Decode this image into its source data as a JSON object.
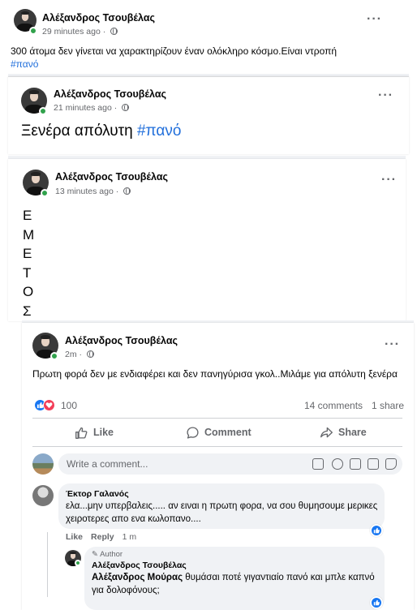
{
  "post1": {
    "author": "Αλέξανδρος Τσουβέλας",
    "time": "29 minutes ago · ",
    "text": "300 άτομα δεν γίνεται να χαρακτηρίζουν έναν ολόκληρο κόσμο.Είναι ντροπή ",
    "hashtag": "#πανό",
    "more": "···"
  },
  "post2": {
    "author": "Αλέξανδρος Τσουβέλας",
    "time": "21 minutes ago · ",
    "text": "Ξενέρα απόλυτη ",
    "hashtag": "#πανό",
    "more": "···"
  },
  "post3": {
    "author": "Αλέξανδρος Τσουβέλας",
    "time": "13 minutes ago · ",
    "letters": [
      "Ε",
      "Μ",
      "Ε",
      "Τ",
      "Ο",
      "Σ"
    ],
    "more": "···"
  },
  "post4": {
    "author": "Αλέξανδρος Τσουβέλας",
    "time": "2m · ",
    "text": "Πρωτη φορά δεν με ενδιαφέρει και δεν πανηγύρισα γκολ..Μιλάμε για απόλυτη ξενέρα",
    "more": "···",
    "reaction_count": "100",
    "comments_count": "14 comments",
    "shares_count": "1 share",
    "actions": {
      "like": "Like",
      "comment": "Comment",
      "share": "Share"
    },
    "comment_placeholder": "Write a comment..."
  },
  "comments": [
    {
      "author": "Έκτορ Γαλανός",
      "text": "ελα...μην υπερβαλεις..... αν ειναι η πρωτη φορα, να σου θυμησουμε μερικες χειροτερες απο ενα κωλοπανο....",
      "like": "Like",
      "reply": "Reply",
      "time": "1 m"
    },
    {
      "badge": "Author",
      "author": "Αλέξανδρος Τσουβέλας",
      "tag": "Αλέξανδρος Μούρας",
      "text": " θυμάσαι ποτέ γιγαντιαίο πανό και μπλε καπνό για δολοφόνους;"
    }
  ],
  "colors": {
    "link": "#216fdb",
    "online": "#31a24c",
    "like": "#1877f2",
    "love": "#f33e58"
  },
  "icons": [
    "globe-icon",
    "more-icon",
    "like-icon",
    "comment-icon",
    "share-icon",
    "sticker-icon",
    "emoji-icon",
    "camera-icon",
    "gif-icon",
    "avatar-sticker-icon",
    "pencil-icon"
  ]
}
